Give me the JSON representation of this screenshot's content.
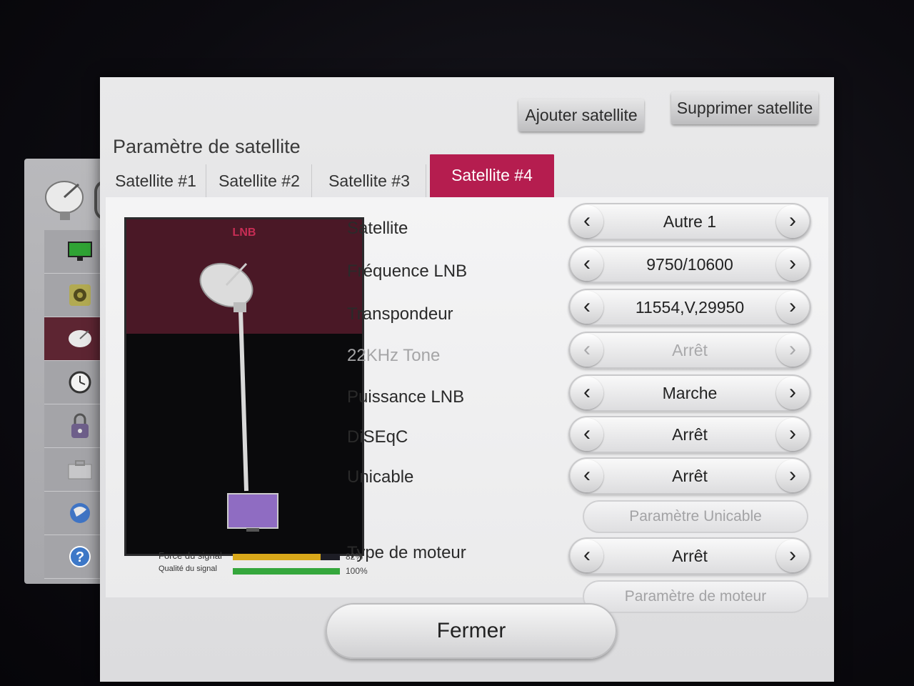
{
  "dialog": {
    "title": "Paramètre de satellite",
    "add_label": "Ajouter satellite",
    "delete_label": "Supprimer satellite",
    "close_label": "Fermer"
  },
  "tabs": [
    "Satellite #1",
    "Satellite #2",
    "Satellite #3",
    "Satellite #4"
  ],
  "active_tab": 3,
  "preview": {
    "lnb_label": "LNB",
    "signal_strength_label": "Force du signal",
    "signal_quality_label": "Qualité du signal",
    "signal_strength_pct": "82%",
    "signal_quality_pct": "100%",
    "signal_strength_value": 0.82,
    "signal_quality_value": 1.0
  },
  "settings": [
    {
      "label": "Satellite",
      "value": "Autre 1",
      "disabled": false
    },
    {
      "label": "Fréquence LNB",
      "value": "9750/10600",
      "disabled": false
    },
    {
      "label": "Transpondeur",
      "value": "11554,V,29950",
      "disabled": false
    },
    {
      "label": "22KHz Tone",
      "value": "Arrêt",
      "disabled": true
    },
    {
      "label": "Puissance LNB",
      "value": "Marche",
      "disabled": false
    },
    {
      "label": "DiSEqC",
      "value": "Arrêt",
      "disabled": false
    },
    {
      "label": "Unicable",
      "value": "Arrêt",
      "disabled": false
    }
  ],
  "unicable_settings_label": "Paramètre Unicable",
  "motor": {
    "label": "Type de moteur",
    "value": "Arrêt"
  },
  "motor_settings_label": "Paramètre de moteur",
  "colors": {
    "accent": "#b51d4f",
    "strength_bar": "#d9a81a",
    "quality_bar": "#35a73c"
  }
}
